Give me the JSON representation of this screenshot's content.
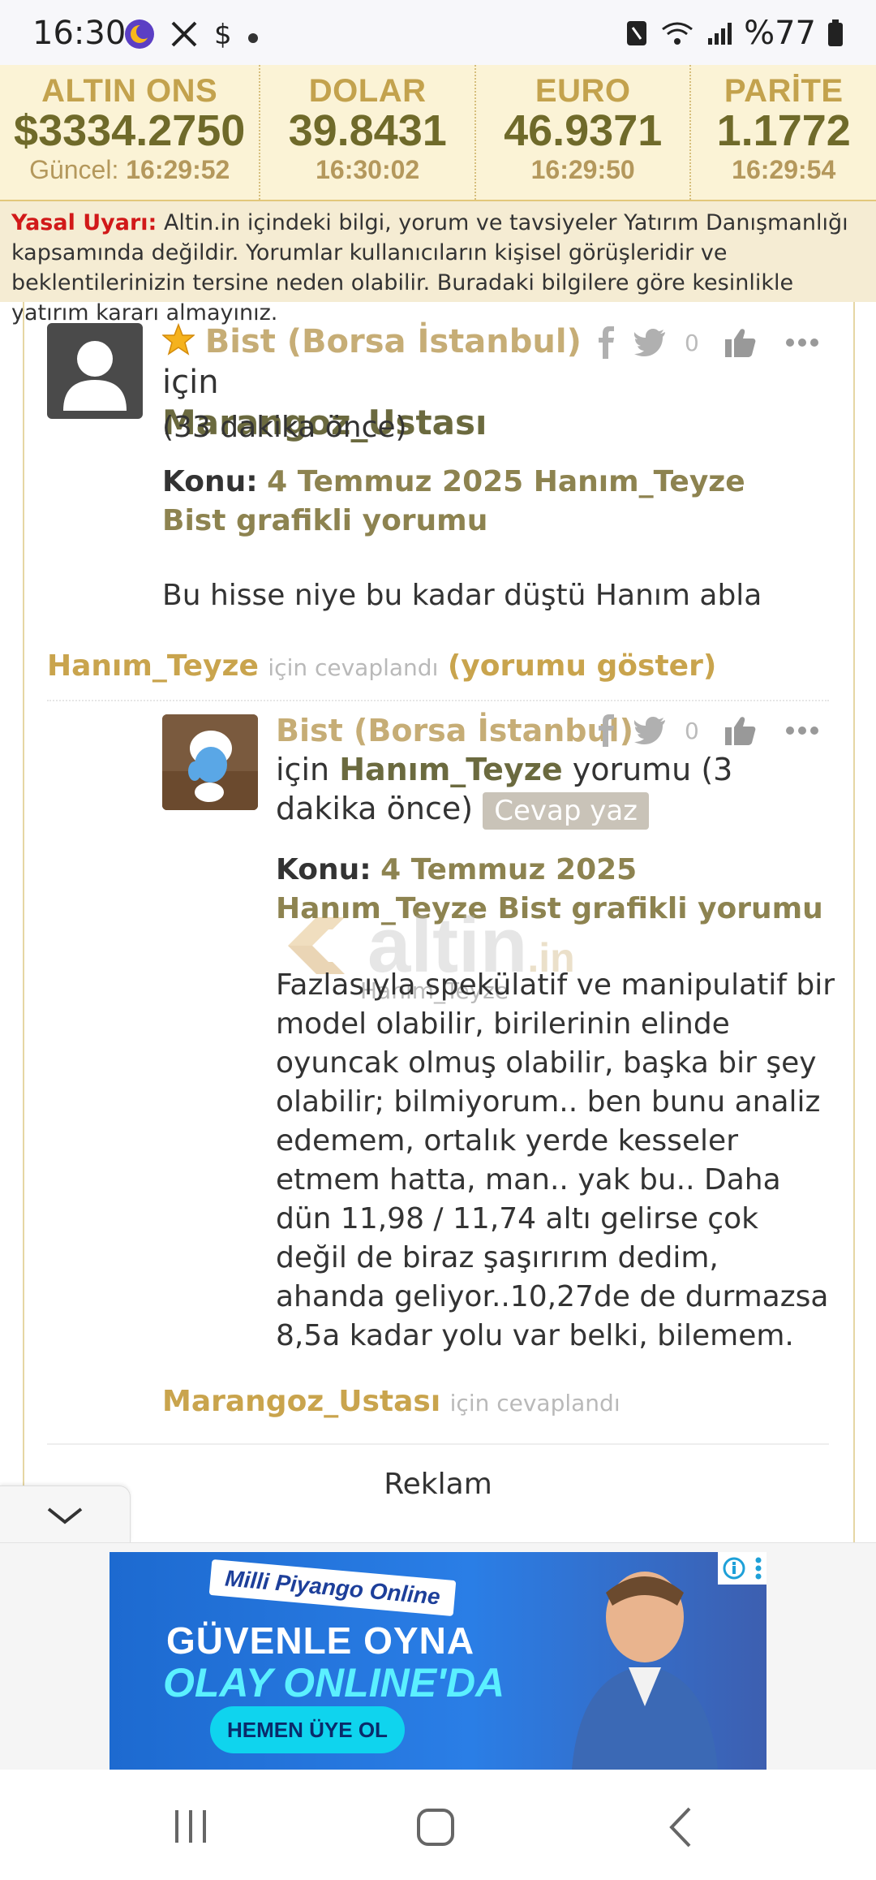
{
  "status_bar": {
    "time": "16:30",
    "battery": "%77",
    "icons": [
      "moon-notification-icon",
      "x-icon",
      "dollar-icon",
      "dot-icon",
      "nfc-icon",
      "wifi-icon",
      "signal-icon",
      "battery-icon"
    ]
  },
  "ticker": [
    {
      "label": "ALTIN ONS",
      "value": "$3334.2750",
      "time_prefix": "Güncel:",
      "time": "16:29:52"
    },
    {
      "label": "DOLAR",
      "value": "39.8431",
      "time_prefix": "",
      "time": "16:30:02"
    },
    {
      "label": "EURO",
      "value": "46.9371",
      "time_prefix": "",
      "time": "16:29:50"
    },
    {
      "label": "PARİTE",
      "value": "1.1772",
      "time_prefix": "",
      "time": "16:29:54"
    }
  ],
  "legal": {
    "label": "Yasal Uyarı:",
    "text": "Altin.in içindeki bilgi, yorum ve tavsiyeler Yatırım Danışmanlığı kapsamında değildir. Yorumlar kullanıcıların kişisel görüşleridir ve beklentilerinizin tersine neden olabilir. Buradaki bilgilere göre kesinlikle yatırım kararı almayınız."
  },
  "comment1": {
    "category": "Bist (Borsa İstanbul)",
    "for_word": "için",
    "user": "Marangoz_Ustası",
    "time": "(33 dakika önce)",
    "like_count": "0",
    "konu_label": "Konu:",
    "konu_title": "4 Temmuz 2025 Hanım_Teyze Bist grafikli yorumu",
    "body": "Bu hisse niye bu kadar düştü Hanım abla",
    "reply_user": "Hanım_Teyze",
    "reply_suffix": "için cevaplandı",
    "show_link": "(yorumu göster)"
  },
  "comment2": {
    "category": "Bist (Borsa İstanbul)",
    "for_word": "için",
    "user": "Hanım_Teyze",
    "time": "yorumu (3 dakika önce)",
    "reply_button": "Cevap yaz",
    "like_count": "0",
    "konu_label": "Konu:",
    "konu_title": "4 Temmuz 2025 Hanım_Teyze Bist grafikli yorumu",
    "body": "Fazlasıyla spekülatif ve manipulatif bir model olabilir, birilerinin elinde oyuncak olmuş olabilir, başka bir şey olabilir; bilmiyorum.. ben bunu analiz edemem, ortalık yerde kesseler etmem hatta, man.. yak bu.. Daha dün 11,98 / 11,74 altı gelirse çok değil de biraz şaşırırım dedim, ahanda geliyor..10,27de de durmazsa 8,5a kadar yolu var belki, bilemem.",
    "reply_user": "Marangoz_Ustası",
    "reply_suffix": "için cevaplandı"
  },
  "watermark": {
    "brand": "altin",
    "tld": ".in",
    "sub": "Hanım_Teyze"
  },
  "reklam": "Reklam",
  "ad": {
    "brand": "Milli Piyango Online",
    "headline1": "GÜVENLE OYNA",
    "headline2": "OLAY ONLINE'DA",
    "cta": "HEMEN ÜYE OL"
  }
}
